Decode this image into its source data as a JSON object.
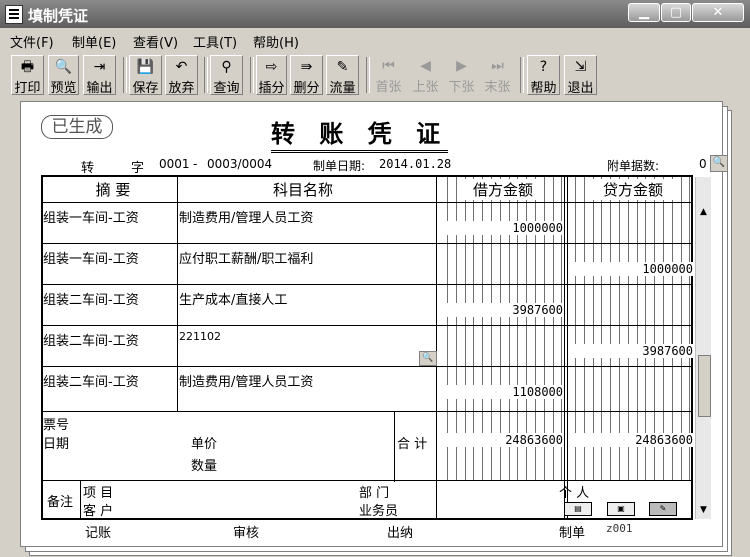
{
  "window": {
    "title": "填制凭证"
  },
  "menu": [
    "文件(F)",
    "制单(E)",
    "查看(V)",
    "工具(T)",
    "帮助(H)"
  ],
  "toolbar": {
    "print": "打印",
    "preview": "预览",
    "export": "输出",
    "save": "保存",
    "discard": "放弃",
    "query": "查询",
    "insert": "插分",
    "delete": "删分",
    "flow": "流量",
    "first": "首张",
    "prev": "上张",
    "next": "下张",
    "last": "末张",
    "help": "帮助",
    "exit": "退出"
  },
  "voucher": {
    "stamp": "已生成",
    "title": "转 账 凭 证",
    "type_char1": "转",
    "type_char2": "字",
    "no_prefix": "0001",
    "no_dash": "-",
    "no": "0003/0004",
    "date_label": "制单日期:",
    "date": "2014.01.28",
    "attach_label": "附单据数:",
    "attach_count": "0"
  },
  "table": {
    "headers": {
      "summary": "摘  要",
      "account": "科目名称",
      "debit": "借方金额",
      "credit": "贷方金额"
    },
    "rows": [
      {
        "summary": "组装一车间-工资",
        "account": "制造费用/管理人员工资",
        "debit": "1000000",
        "credit": ""
      },
      {
        "summary": "组装一车间-工资",
        "account": "应付职工薪酬/职工福利",
        "debit": "",
        "credit": "1000000"
      },
      {
        "summary": "组装二车间-工资",
        "account": "生产成本/直接人工",
        "debit": "3987600",
        "credit": ""
      },
      {
        "summary": "组装二车间-工资",
        "account": "221102",
        "debit": "",
        "credit": "3987600"
      },
      {
        "summary": "组装二车间-工资",
        "account": "制造费用/管理人员工资",
        "debit": "1108000",
        "credit": ""
      }
    ],
    "ticket_no": "票号",
    "date_label": "日期",
    "unit_price": "单价",
    "quantity": "数量",
    "total_label": "合 计",
    "total_debit": "24863600",
    "total_credit": "24863600",
    "remark": "备注",
    "project": "项  目",
    "customer": "客  户",
    "dept": "部  门",
    "salesman": "业务员",
    "person": "个  人"
  },
  "footer": {
    "bookkeeping": "记账",
    "review": "审核",
    "cashier": "出纳",
    "maker": "制单",
    "maker_name": "z001"
  }
}
